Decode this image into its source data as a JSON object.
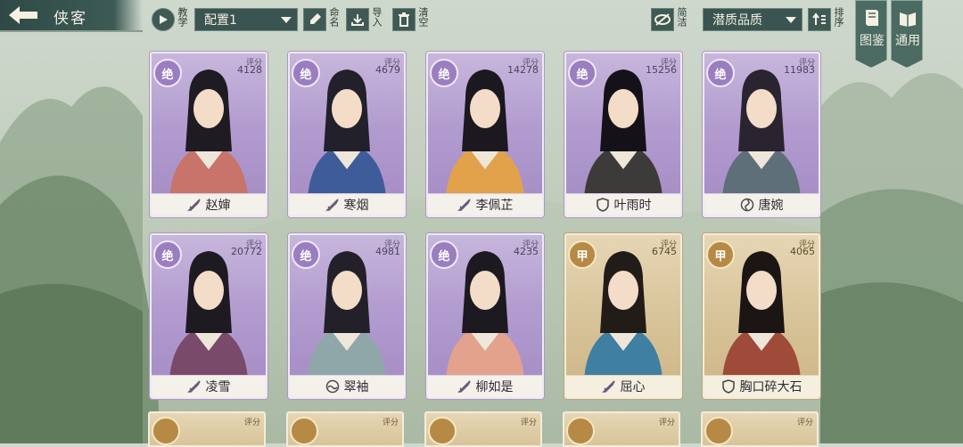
{
  "header": {
    "title": "侠客",
    "tutorial_label": "教学",
    "config_select": "配置1",
    "rename_label": "命名",
    "import_label": "导入",
    "clear_label": "清空",
    "simple_label": "简洁",
    "sort_select": "潜质品质",
    "sort_label": "排序",
    "codex_label": "图鉴",
    "general_label": "通用"
  },
  "score_label": "评分",
  "cards": [
    {
      "name": "赵婶",
      "grade": "绝",
      "score": "4128",
      "tier": "purple",
      "badge": "sword-icon"
    },
    {
      "name": "寒烟",
      "grade": "绝",
      "score": "4679",
      "tier": "purple",
      "badge": "sword-icon"
    },
    {
      "name": "李佩芷",
      "grade": "绝",
      "score": "14278",
      "tier": "purple",
      "badge": "sword-icon"
    },
    {
      "name": "叶雨时",
      "grade": "绝",
      "score": "15256",
      "tier": "purple",
      "badge": "shield-icon"
    },
    {
      "name": "唐婉",
      "grade": "绝",
      "score": "11983",
      "tier": "purple",
      "badge": "swirl-icon"
    },
    {
      "name": "凌雪",
      "grade": "绝",
      "score": "20772",
      "tier": "purple",
      "badge": "sword-icon"
    },
    {
      "name": "翠袖",
      "grade": "绝",
      "score": "4981",
      "tier": "purple",
      "badge": "wave-icon"
    },
    {
      "name": "柳如是",
      "grade": "绝",
      "score": "4235",
      "tier": "purple",
      "badge": "sword-icon"
    },
    {
      "name": "屈心",
      "grade": "甲",
      "score": "6745",
      "tier": "gold",
      "badge": "sword-icon"
    },
    {
      "name": "胸口碎大石",
      "grade": "甲",
      "score": "4065",
      "tier": "gold",
      "badge": "shield-icon"
    }
  ],
  "colors": {
    "purple_card": "#b29ccf",
    "gold_card": "#d8c49a",
    "toolbar": "#3a5551"
  }
}
